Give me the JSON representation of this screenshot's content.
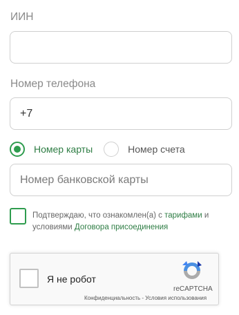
{
  "form": {
    "iin_label": "ИИН",
    "iin_value": "",
    "phone_label": "Номер телефона",
    "phone_value": "+7",
    "radio_card_label": "Номер карты",
    "radio_account_label": "Номер счета",
    "selected_radio": "card",
    "card_placeholder": "Номер банковской карты"
  },
  "consent": {
    "text_before": "Подтверждаю, что ознакомлен(а) с ",
    "tariffs_link": "тарифами",
    "text_middle": " и условиями ",
    "agreement_link": "Договора присоединения"
  },
  "captcha": {
    "label": "Я не робот",
    "brand": "reCAPTCHA",
    "privacy": "Конфиденциальность",
    "separator": " - ",
    "terms": "Условия использования"
  },
  "colors": {
    "accent": "#2e9c4e",
    "link": "#2e7d44"
  }
}
